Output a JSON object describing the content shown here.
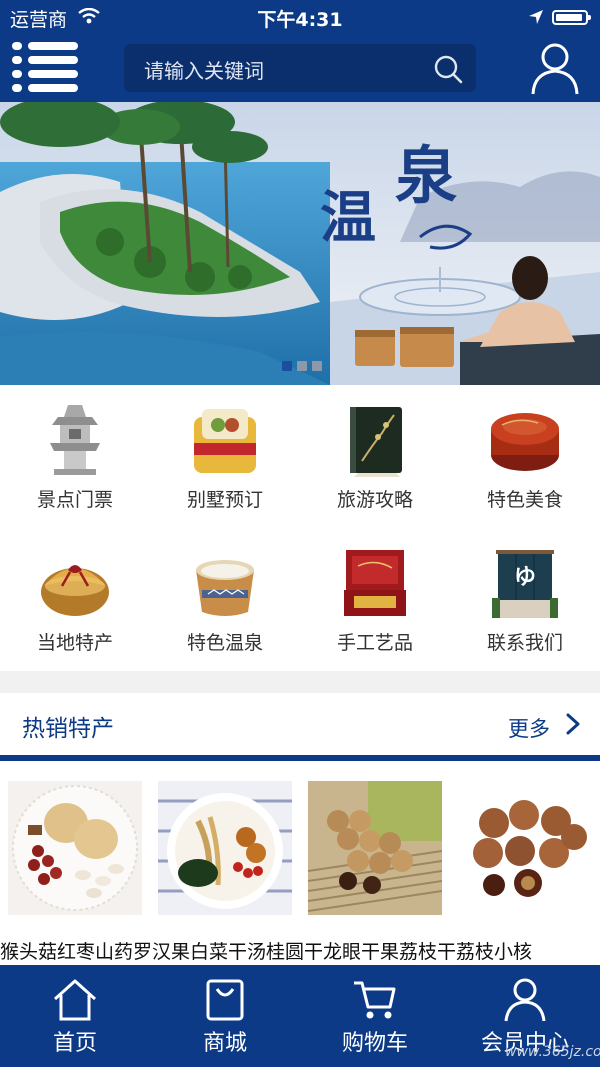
{
  "status_bar": {
    "carrier": "运营商",
    "time": "下午4:31"
  },
  "header": {
    "search_placeholder": "请输入关键词",
    "menu_icon": "menu-icon",
    "search_icon": "search-icon",
    "user_icon": "user-icon"
  },
  "banner": {
    "title_art": "温泉",
    "slide_count": 3,
    "active_slide": 1
  },
  "categories": [
    {
      "label": "景点门票",
      "icon": "pagoda-icon"
    },
    {
      "label": "别墅预订",
      "icon": "gift-box-icon"
    },
    {
      "label": "旅游攻略",
      "icon": "book-icon"
    },
    {
      "label": "特色美食",
      "icon": "lacquer-box-icon"
    },
    {
      "label": "当地特产",
      "icon": "bundle-icon"
    },
    {
      "label": "特色温泉",
      "icon": "bath-tub-icon"
    },
    {
      "label": "手工艺品",
      "icon": "craft-box-icon"
    },
    {
      "label": "联系我们",
      "icon": "noren-curtain-icon"
    }
  ],
  "hot_section": {
    "title": "热销特产",
    "more_label": "更多"
  },
  "products": [
    {
      "name": "猴头菇红枣山药"
    },
    {
      "name": "罗汉果白菜干汤"
    },
    {
      "name": "桂圆干龙眼干果"
    },
    {
      "name": "荔枝干荔枝小核"
    }
  ],
  "tabbar": [
    {
      "label": "首页",
      "icon": "home-icon"
    },
    {
      "label": "商城",
      "icon": "shopping-bag-icon"
    },
    {
      "label": "购物车",
      "icon": "cart-icon"
    },
    {
      "label": "会员中心",
      "icon": "member-icon"
    }
  ],
  "watermark": "www.365jz.com",
  "colors": {
    "primary": "#0c3a86",
    "search_bg": "#0a2f6c",
    "divider": "#f1f1f1"
  }
}
